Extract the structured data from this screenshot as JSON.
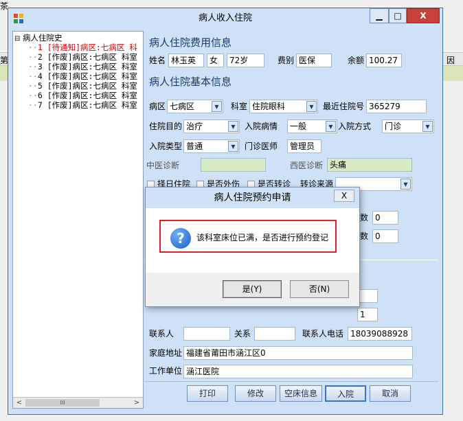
{
  "window": {
    "title": "病人收入住院",
    "min_glyph": "▁",
    "max_glyph": "□",
    "close_glyph": "X"
  },
  "background": {
    "top_left_text": "茶",
    "col1": "第",
    "col2": "因"
  },
  "tree": {
    "root": "病人住院史",
    "root_prefix": "⊟",
    "items": [
      {
        "text": "1 [待通知]病区:七病区 科",
        "color": "#d40000"
      },
      {
        "text": "2 [作废]病区:七病区 科室",
        "color": "#000000"
      },
      {
        "text": "3 [作废]病区:七病区 科室",
        "color": "#000000"
      },
      {
        "text": "4 [作废]病区:七病区 科室",
        "color": "#000000"
      },
      {
        "text": "5 [作废]病区:七病区 科室",
        "color": "#000000"
      },
      {
        "text": "6 [作废]病区:七病区 科室",
        "color": "#000000"
      },
      {
        "text": "7 [作废]病区:七病区 科室",
        "color": "#000000"
      }
    ],
    "scroll_left": "<",
    "scroll_right": ">",
    "scroll_thumb": "III"
  },
  "fee": {
    "section_title": "病人住院费用信息",
    "name_label": "姓名",
    "name_value": "林玉英",
    "gender_value": "女",
    "age_value": "72岁",
    "fee_type_label": "费别",
    "fee_type_value": "医保",
    "balance_label": "余额",
    "balance_value": "100.27"
  },
  "basic": {
    "section_title": "病人住院基本信息",
    "ward_label": "病区",
    "ward_value": "七病区",
    "dept_label": "科室",
    "dept_value": "住院眼科",
    "recent_label": "最近住院号",
    "recent_value": "365279",
    "purpose_label": "住院目的",
    "purpose_value": "治疗",
    "condition_label": "入院病情",
    "condition_value": "一般",
    "method_label": "入院方式",
    "method_value": "门诊",
    "type_label": "入院类型",
    "type_value": "普通",
    "doctor_label": "门诊医师",
    "doctor_value": "管理员",
    "tcm_label": "中医诊断",
    "tcm_value": "",
    "western_label": "西医诊断",
    "western_value": "头痛",
    "chk1_label": "择日住院",
    "chk2_label": "是否外伤",
    "chk3_label": "是否转诊",
    "transfer_label": "转诊来源",
    "transfer_value": "",
    "partial_label_a": "数",
    "partial_value_a": "0",
    "partial_label_b": "数",
    "partial_value_b": "0"
  },
  "contact": {
    "contact_label": "联系人",
    "contact_value": "",
    "relation_label": "关系",
    "relation_value": "",
    "phone_label": "联系人电话",
    "phone_value": "18039088928",
    "address_label": "家庭地址",
    "address_value": "福建省莆田市涵江区0",
    "work_label": "工作单位",
    "work_value": "涵江医院",
    "hidden_tail_value": "1"
  },
  "buttons": {
    "print": "打印",
    "modify": "修改",
    "empty_bed": "空床信息",
    "admit": "入院",
    "cancel": "取消"
  },
  "dialog": {
    "title": "病人住院预约申请",
    "close": "X",
    "icon": "?",
    "message": "该科室床位已满，是否进行预约登记",
    "yes": "是(Y)",
    "no": "否(N)"
  }
}
